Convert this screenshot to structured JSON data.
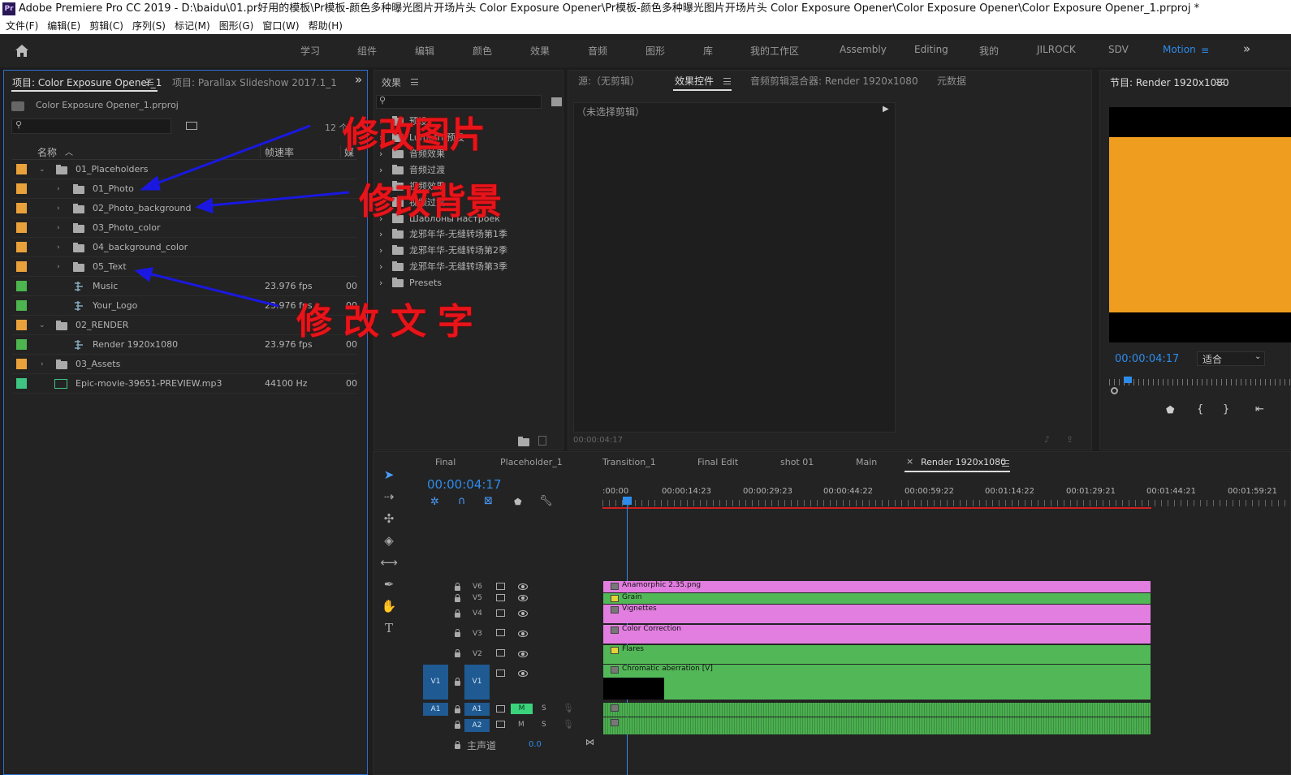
{
  "window": {
    "title": "Adobe Premiere Pro CC 2019 - D:\\baidu\\01.pr好用的模板\\Pr模板-颜色多种曝光图片开场片头 Color Exposure Opener\\Pr模板-颜色多种曝光图片开场片头 Color Exposure Opener\\Color Exposure Opener\\Color Exposure Opener_1.prproj *",
    "logo": "Pr"
  },
  "menu": [
    "文件(F)",
    "编辑(E)",
    "剪辑(C)",
    "序列(S)",
    "标记(M)",
    "图形(G)",
    "窗口(W)",
    "帮助(H)"
  ],
  "workspaces": [
    "学习",
    "组件",
    "编辑",
    "颜色",
    "效果",
    "音频",
    "图形",
    "库",
    "我的工作区",
    "Assembly",
    "Editing",
    "我的",
    "JILROCK",
    "SDV",
    "Motion"
  ],
  "project": {
    "tab_active": "项目: Color Exposure Opener_1",
    "tab_other": "项目: Parallax Slideshow 2017.1_1",
    "file": "Color Exposure Opener_1.prproj",
    "count": "12 个",
    "columns": {
      "name": "名称",
      "fps": "帧速率",
      "media": "媒"
    },
    "items": [
      {
        "name": "01_Placeholders",
        "fps": "",
        "media": ""
      },
      {
        "name": "01_Photo",
        "fps": "",
        "media": ""
      },
      {
        "name": "02_Photo_background",
        "fps": "",
        "media": ""
      },
      {
        "name": "03_Photo_color",
        "fps": "",
        "media": ""
      },
      {
        "name": "04_background_color",
        "fps": "",
        "media": ""
      },
      {
        "name": "05_Text",
        "fps": "",
        "media": ""
      },
      {
        "name": "Music",
        "fps": "23.976 fps",
        "media": "00"
      },
      {
        "name": "Your_Logo",
        "fps": "23.976 fps",
        "media": "00"
      },
      {
        "name": "02_RENDER",
        "fps": "",
        "media": ""
      },
      {
        "name": "Render 1920x1080",
        "fps": "23.976 fps",
        "media": "00"
      },
      {
        "name": "03_Assets",
        "fps": "",
        "media": ""
      },
      {
        "name": "Epic-movie-39651-PREVIEW.mp3",
        "fps": "44100 Hz",
        "media": "00"
      }
    ],
    "label_colors": [
      "#e9a23b",
      "#e9a23b",
      "#e9a23b",
      "#e9a23b",
      "#e9a23b",
      "#e9a23b",
      "#4cb550",
      "#4cb550",
      "#e9a23b",
      "#4cb550",
      "#e9a23b",
      "#3fc383"
    ]
  },
  "annotations": {
    "a1": "修改图片",
    "a2": "修改背景",
    "a3": "修改文字"
  },
  "effects": {
    "title": "效果",
    "items": [
      "预设",
      "Lumetri 预设",
      "音频效果",
      "音频过渡",
      "视频效果",
      "视频过渡",
      "Шаблоны настроек",
      "龙邪年华-无缝转场第1季",
      "龙邪年华-无缝转场第2季",
      "龙邪年华-无缝转场第3季",
      "Presets"
    ]
  },
  "source": {
    "tab_source": "源:（无剪辑）",
    "tab_effects": "效果控件",
    "tab_mixer": "音频剪辑混合器: Render 1920x1080",
    "tab_meta": "元数据",
    "no_clip": "（未选择剪辑）",
    "timecode": "00:00:04:17"
  },
  "program": {
    "title": "节目: Render 1920x1080",
    "timecode": "00:00:04:17",
    "fit": "适合",
    "frame_color": "#ef9d1e"
  },
  "timeline": {
    "tabs": [
      "Final",
      "Placeholder_1",
      "Transition_1",
      "Final Edit",
      "shot 01",
      "Main",
      "Render 1920x1080"
    ],
    "timecode": "00:00:04:17",
    "ruler": [
      ":00:00",
      "00:00:14:23",
      "00:00:29:23",
      "00:00:44:22",
      "00:00:59:22",
      "00:01:14:22",
      "00:01:29:21",
      "00:01:44:21",
      "00:01:59:21"
    ],
    "tracks": [
      {
        "name": "V6",
        "clip": "Anamorphic 2.35.png",
        "color": "pink"
      },
      {
        "name": "V5",
        "clip": "Grain",
        "color": "green"
      },
      {
        "name": "V4",
        "clip": "Vignettes",
        "color": "pink"
      },
      {
        "name": "V3",
        "clip": "Color Correction",
        "color": "pink"
      },
      {
        "name": "V2",
        "clip": "Flares",
        "color": "green"
      },
      {
        "name": "V1",
        "clip": "Chromatic aberration [V]",
        "color": "green"
      }
    ],
    "audio": [
      {
        "name": "A1",
        "m": "M",
        "s": "S"
      },
      {
        "name": "A2",
        "m": "M",
        "s": "S"
      }
    ],
    "master": {
      "label": "主声道",
      "value": "0.0"
    }
  }
}
